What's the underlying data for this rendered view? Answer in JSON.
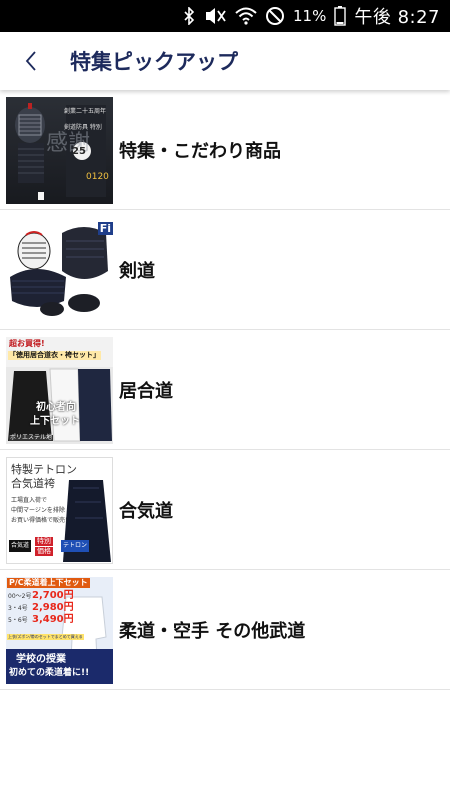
{
  "status_bar": {
    "battery_percent": "11%",
    "time": "午後 8:27",
    "icons": [
      "bluetooth-icon",
      "mute-vibrate-icon",
      "wifi-icon",
      "do-not-disturb-icon",
      "battery-icon"
    ]
  },
  "app_bar": {
    "back_icon": "chevron-left-icon",
    "title": "特集ピックアップ"
  },
  "items": [
    {
      "label": "特集・こだわり商品",
      "thumb": {
        "line1": "創業二十五周年",
        "line2": "剣道防具 特別",
        "big": "25",
        "kanji": "感謝",
        "tel": "0120"
      }
    },
    {
      "label": "剣道",
      "thumb": {
        "badge": "Fi"
      }
    },
    {
      "label": "居合道",
      "thumb": {
        "top": "超お買得!",
        "banner": "「徳用居合道衣・袴セット」",
        "mid1": "初心者向",
        "mid2": "上下セット",
        "foot": "ポリエステル地"
      }
    },
    {
      "label": "合気道",
      "thumb": {
        "t1": "特製テトロン",
        "t2": "合気道袴",
        "d1": "工場直入荷で",
        "d2": "中間マージンを排除",
        "d3": "お買い得価格で販売!",
        "tag1": "合気道",
        "tag2a": "特別",
        "tag2b": "価格",
        "tag3": "テトロン"
      }
    },
    {
      "label": "柔道・空手 その他武道",
      "thumb": {
        "head": "P/C柔道着上下セット",
        "s1": "00～2号",
        "p1": "2,700円",
        "s2": "3・4号",
        "p2": "2,980円",
        "s3": "5・6号",
        "p3": "3,490円",
        "note": "上衣/ズボン/帯のセットでまとめて買える",
        "l1": "学校の授業",
        "l2": "初めての柔道着に!!"
      }
    }
  ]
}
